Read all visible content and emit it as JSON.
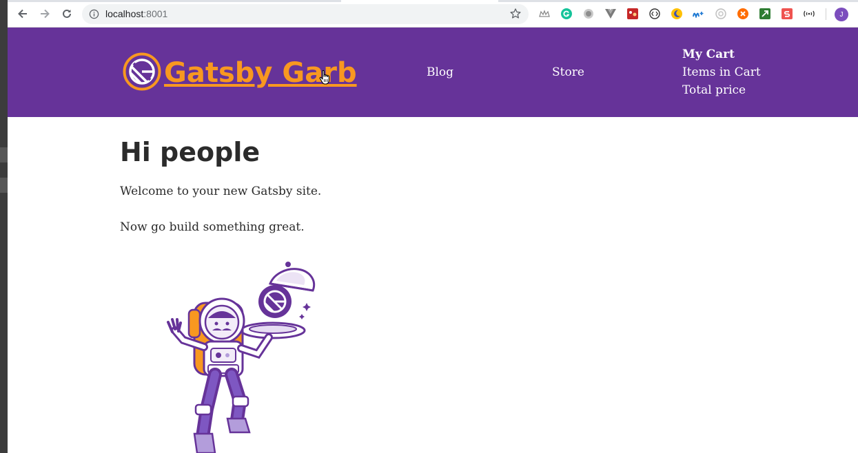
{
  "browser": {
    "url_host": "localhost",
    "url_port": ":8001",
    "extensions": [
      "crown-extension-icon",
      "grammarly-icon",
      "record-icon",
      "vue-devtools-icon",
      "red-extension-icon",
      "code-extension-icon",
      "moon-extension-icon",
      "movistar-extension-icon",
      "circle-extension-icon",
      "orange-extension-icon",
      "green-extension-icon",
      "red-s-extension-icon",
      "wifi-extension-icon"
    ],
    "profile_initial": "J",
    "profile_color": "#7c4dbd"
  },
  "header": {
    "brand": "Gatsby Garb",
    "nav": {
      "blog": "Blog",
      "store": "Store"
    },
    "cart": {
      "title": "My Cart",
      "items": "Items in Cart",
      "total": "Total price"
    },
    "colors": {
      "background": "#663399",
      "brand": "#f89820"
    }
  },
  "main": {
    "heading": "Hi people",
    "paragraph1": "Welcome to your new Gatsby site.",
    "paragraph2": "Now go build something great."
  }
}
